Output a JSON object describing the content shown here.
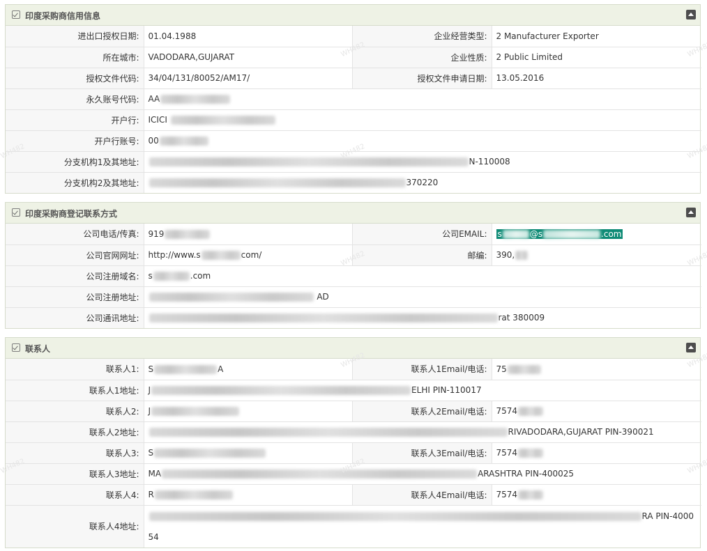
{
  "panels": [
    {
      "title": "印度采购商信用信息",
      "rows": [
        {
          "l1": "进出口授权日期:",
          "v1": "01.04.1988",
          "l2": "企业经营类型:",
          "v2": "2 Manufacturer Exporter"
        },
        {
          "l1": "所在城市:",
          "v1": "VADODARA,GUJARAT",
          "l2": "企业性质:",
          "v2": "2 Public Limited"
        },
        {
          "l1": "授权文件代码:",
          "v1": "34/04/131/80052/AM17/",
          "l2": "授权文件申请日期:",
          "v2": "13.05.2016"
        },
        {
          "l1": "永久账号代码:",
          "v1_pre": "AA",
          "v1_post": ""
        },
        {
          "l1": "开户行:",
          "v1_pre": "ICICI ",
          "v1_post": ""
        },
        {
          "l1": "开户行账号:",
          "v1_pre": "00",
          "v1_post": ""
        },
        {
          "l1": "分支机构1及其地址:",
          "v1_pre": "",
          "v1_post": "N-110008"
        },
        {
          "l1": "分支机构2及其地址:",
          "v1_pre": "",
          "v1_post": "370220"
        }
      ]
    },
    {
      "title": "印度采购商登记联系方式",
      "rows": [
        {
          "l1": "公司电话/传真:",
          "v1_pre": "919",
          "v1_post": "",
          "l2": "公司EMAIL:",
          "v2_pre": "s",
          "v2_mid": "@s",
          "v2_post": ".com"
        },
        {
          "l1": "公司官网网址:",
          "v1_pre": "http://www.s",
          "v1_post": "com/",
          "l2": "邮编:",
          "v2_pre": "390,",
          "v2_post": ""
        },
        {
          "l1": "公司注册域名:",
          "v1_pre": "s",
          "v1_post": ".com"
        },
        {
          "l1": "公司注册地址:",
          "v1_pre": "",
          "v1_post": "AD"
        },
        {
          "l1": "公司通讯地址:",
          "v1_pre": "",
          "v1_post": "rat 380009"
        }
      ]
    },
    {
      "title": "联系人",
      "rows": [
        {
          "l1": "联系人1:",
          "v1_pre": "S",
          "v1_post": "A",
          "l2": "联系人1Email/电话:",
          "v2_pre": "75",
          "v2_post": ""
        },
        {
          "l1": "联系人1地址:",
          "v1_pre": "J",
          "v1_post": "ELHI PIN-110017"
        },
        {
          "l1": "联系人2:",
          "v1_pre": "J",
          "v1_post": "",
          "l2": "联系人2Email/电话:",
          "v2_pre": "7574",
          "v2_post": ""
        },
        {
          "l1": "联系人2地址:",
          "v1_pre": "",
          "v1_post": "RIVADODARA,GUJARAT PIN-390021"
        },
        {
          "l1": "联系人3:",
          "v1_pre": "S",
          "v1_post": "",
          "l2": "联系人3Email/电话:",
          "v2_pre": "7574",
          "v2_post": ""
        },
        {
          "l1": "联系人3地址:",
          "v1_pre": "MA",
          "v1_post": "ARASHTRA PIN-400025"
        },
        {
          "l1": "联系人4:",
          "v1_pre": "R",
          "v1_post": "",
          "l2": "联系人4Email/电话:",
          "v2_pre": "7574",
          "v2_post": ""
        },
        {
          "l1": "联系人4地址:",
          "v1_pre": "",
          "v1_post": "RA PIN-4000",
          "v1_line2": "54"
        }
      ]
    }
  ],
  "watermark": "WH482",
  "colors": {
    "header_bg": "#eef2e5",
    "label_bg": "#f7f7f7",
    "highlight": "#0f8b76",
    "collapse_btn": "#4d4d4d"
  }
}
